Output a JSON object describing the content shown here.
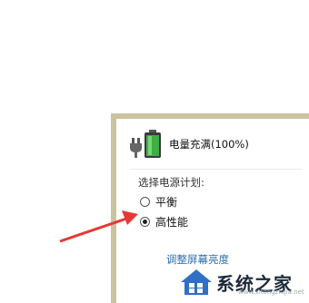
{
  "battery": {
    "status_text": "电量充满(100%)",
    "icon": "battery-plugged-icon"
  },
  "power_plan": {
    "heading": "选择电源计划:",
    "options": [
      {
        "label": "平衡",
        "selected": false
      },
      {
        "label": "高性能",
        "selected": true
      }
    ]
  },
  "links": {
    "brightness": "调整屏幕亮度"
  },
  "watermark": {
    "brand": "系统之家",
    "url": "www.xitongzhijia.net"
  },
  "colors": {
    "flyout_border": "#c9c3a0",
    "battery_fill": "#3cb043",
    "arrow": "#e53935",
    "link": "#2a6fb0"
  }
}
